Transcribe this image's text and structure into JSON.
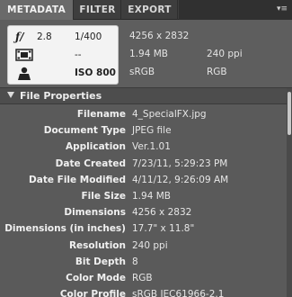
{
  "tabs": [
    {
      "label": "METADATA",
      "active": true
    },
    {
      "label": "FILTER",
      "active": false
    },
    {
      "label": "EXPORT",
      "active": false
    }
  ],
  "panel_menu_icon": "panel-menu-icon",
  "camera_info": {
    "aperture": "2.8",
    "shutter": "1/400",
    "exposure_comp": "--",
    "iso": "ISO 800",
    "icons": [
      "aperture-icon",
      "metering-mode-icon",
      "white-balance-icon"
    ]
  },
  "file_summary": {
    "dimensions": "4256 x 2832",
    "file_size": "1.94 MB",
    "resolution": "240 ppi",
    "color_profile": "sRGB",
    "color_mode": "RGB"
  },
  "section": {
    "label": "File Properties",
    "expanded": true
  },
  "properties": [
    {
      "label": "Filename",
      "value": "4_SpecialFX.jpg"
    },
    {
      "label": "Document Type",
      "value": "JPEG file"
    },
    {
      "label": "Application",
      "value": "Ver.1.01"
    },
    {
      "label": "Date Created",
      "value": "7/23/11, 5:29:23 PM"
    },
    {
      "label": "Date File Modified",
      "value": "4/11/12, 9:26:09 AM"
    },
    {
      "label": "File Size",
      "value": "1.94 MB"
    },
    {
      "label": "Dimensions",
      "value": "4256 x 2832"
    },
    {
      "label": "Dimensions (in inches)",
      "value": "17.7\" x 11.8\""
    },
    {
      "label": "Resolution",
      "value": "240 ppi"
    },
    {
      "label": "Bit Depth",
      "value": "8"
    },
    {
      "label": "Color Mode",
      "value": "RGB"
    },
    {
      "label": "Color Profile",
      "value": "sRGB IEC61966-2.1"
    }
  ]
}
